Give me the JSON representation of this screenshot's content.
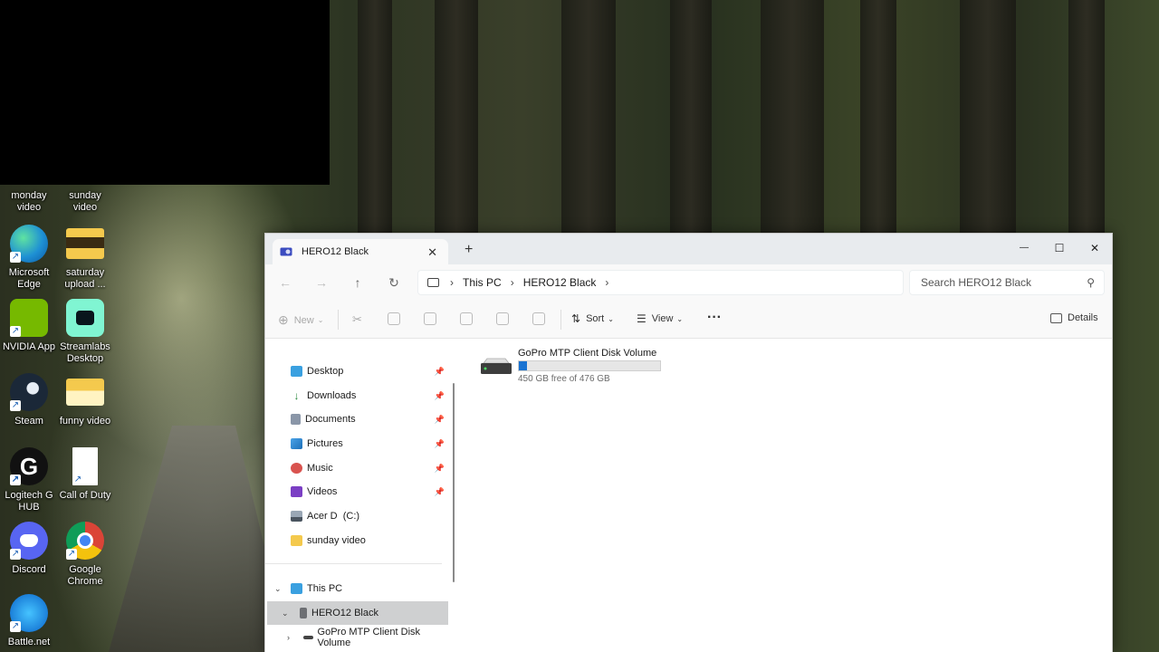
{
  "desktop": {
    "icons": [
      {
        "label": "monday video",
        "icon": "folder-icon"
      },
      {
        "label": "sunday video",
        "icon": "folder-icon"
      },
      {
        "label": "Microsoft Edge",
        "icon": "edge-icon"
      },
      {
        "label": "saturday upload ...",
        "icon": "folder-icon"
      },
      {
        "label": "NVIDIA App",
        "icon": "nvidia-icon"
      },
      {
        "label": "Streamlabs Desktop",
        "icon": "streamlabs-icon"
      },
      {
        "label": "Steam",
        "icon": "steam-icon"
      },
      {
        "label": "funny video",
        "icon": "folder-icon"
      },
      {
        "label": "Logitech G HUB",
        "icon": "logitech-icon"
      },
      {
        "label": "Call of Duty",
        "icon": "file-icon"
      },
      {
        "label": "Discord",
        "icon": "discord-icon"
      },
      {
        "label": "Google Chrome",
        "icon": "chrome-icon"
      },
      {
        "label": "Battle.net",
        "icon": "battlenet-icon"
      }
    ]
  },
  "window": {
    "tab_title": "HERO12 Black",
    "tab_close": "✕",
    "tab_add": "+",
    "controls": {
      "minimize": "—",
      "maximize": "☐",
      "close": "✕"
    }
  },
  "address": {
    "back": "←",
    "forward": "→",
    "up": "↑",
    "refresh": "↻",
    "crumbs": [
      "This PC",
      "HERO12 Black"
    ],
    "separator": "›",
    "search_placeholder": "Search HERO12 Black"
  },
  "toolbar": {
    "new_label": "New",
    "sort_label": "Sort",
    "view_label": "View",
    "more_label": "···",
    "details_label": "Details"
  },
  "nav": {
    "quick": [
      {
        "label": "Desktop",
        "icon": "desktop-icon",
        "pinned": true
      },
      {
        "label": "Downloads",
        "icon": "downloads-icon",
        "pinned": true
      },
      {
        "label": "Documents",
        "icon": "documents-icon",
        "pinned": true
      },
      {
        "label": "Pictures",
        "icon": "pictures-icon",
        "pinned": true
      },
      {
        "label": "Music",
        "icon": "music-icon",
        "pinned": true
      },
      {
        "label": "Videos",
        "icon": "videos-icon",
        "pinned": true
      },
      {
        "label": "Acer D  (C:)",
        "icon": "drive-icon",
        "pinned": false
      },
      {
        "label": "sunday video",
        "icon": "folder-icon",
        "pinned": false
      }
    ],
    "this_pc": "This PC",
    "device": "HERO12 Black",
    "sub_device": "GoPro MTP Client Disk Volume"
  },
  "colors": {
    "accent": "#1a73d2"
  },
  "content": {
    "drive_name": "GoPro MTP Client Disk Volume",
    "drive_free": "450 GB free of 476 GB",
    "usage_fraction": 0.055
  }
}
